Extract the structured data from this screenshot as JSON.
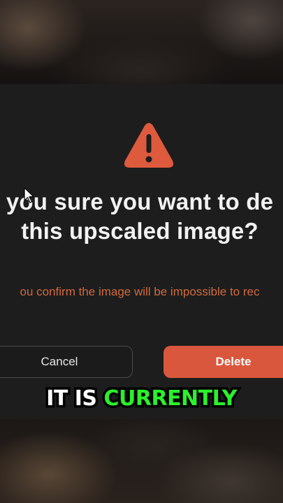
{
  "dialog": {
    "title_line1": "you sure you want to de",
    "title_line2": "this upscaled image?",
    "subtext": "ou confirm the image will be impossible to rec",
    "cancel_label": "Cancel",
    "delete_label": "Delete",
    "icon": "warning-triangle-icon"
  },
  "caption": {
    "part1": "IT IS ",
    "part2": "CURRENTLY"
  },
  "colors": {
    "dialog_bg": "#1d1d1d",
    "title": "#f2f2f2",
    "subtext": "#d06a3d",
    "delete_bg": "#d9573d",
    "warning_icon": "#dd5a3d",
    "caption_white": "#ffffff",
    "caption_green": "#2bf02b"
  }
}
